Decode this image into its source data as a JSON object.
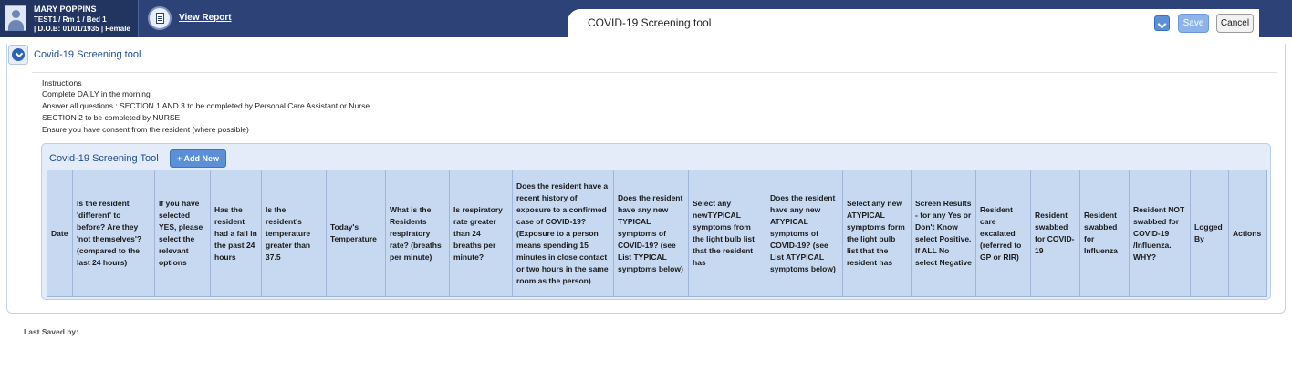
{
  "patient": {
    "name": "MARY POPPINS",
    "location": "TEST1 / Rm 1 / Bed 1",
    "details": "| D.O.B: 01/01/1935 | Female"
  },
  "header": {
    "view_report_label": "View Report",
    "form_title": "COVID-19 Screening tool",
    "save_label": "Save",
    "cancel_label": "Cancel"
  },
  "section": {
    "title": "Covid-19 Screening tool"
  },
  "instructions": [
    "Instructions",
    "Complete DAILY in the morning",
    "Answer all questions : SECTION 1 AND 3 to be completed by Personal Care Assistant or Nurse",
    "SECTION 2 to be completed by NURSE",
    "Ensure you have consent from the resident (where possible)"
  ],
  "grid": {
    "title": "Covid-19 Screening Tool",
    "add_label": "+ Add New",
    "columns": [
      "Date",
      "Is the resident 'different' to before? Are they 'not themselves'? (compared to the last 24 hours)",
      "If you have selected YES, please select the relevant options",
      "Has the resident had a fall in the past 24 hours",
      "Is the resident's temperature greater than 37.5",
      "Today's Temperature",
      "What is the Residents respiratory rate? (breaths per minute)",
      "Is respiratory rate greater than 24 breaths per minute?",
      "Does the resident have a recent history of exposure to a confirmed case of COVID-19? (Exposure to a person means spending 15 minutes in close contact or two hours in the same room as the person)",
      "Does the resident have any new TYPICAL symptoms of COVID-19? (see List TYPICAL symptoms below)",
      "Select any newTYPICAL symptoms from the light bulb list that the resident has",
      "Does the resident have any new ATYPICAL symptoms of COVID-19? (see List ATYPICAL symptoms below)",
      "Select any new ATYPICAL symptoms form the light bulb list that the resident has",
      "Screen Results - for any Yes or Don't Know select Positive. If ALL No select Negative",
      "Resident care excalated (referred to GP or RIR)",
      "Resident swabbed for COVID-19",
      "Resident swabbed for Influenza",
      "Resident NOT swabbed for COVID-19 /Influenza. WHY?",
      "Logged By",
      "Actions"
    ]
  },
  "footer": {
    "last_saved_label": "Last Saved by:"
  }
}
